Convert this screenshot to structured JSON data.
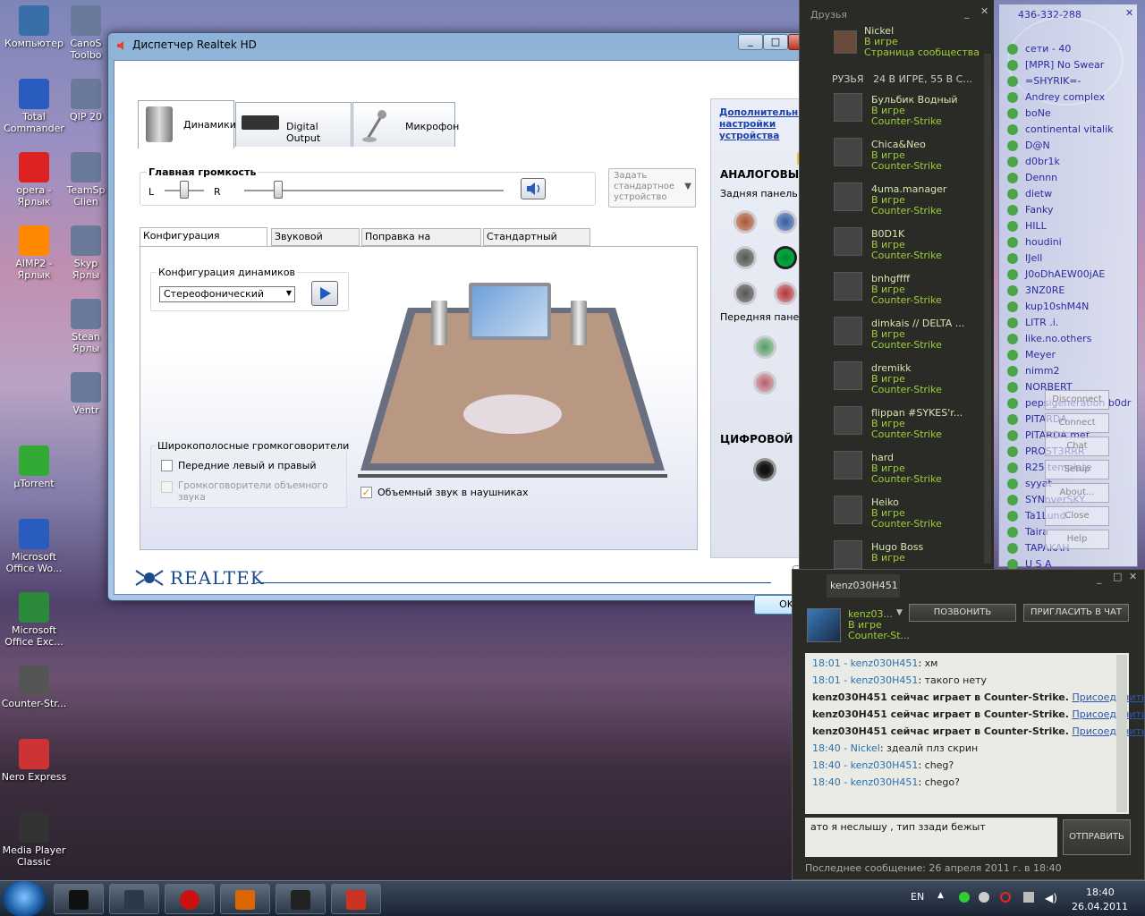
{
  "desktop_icons": [
    {
      "label": "Компьютер",
      "icon": "computer-icon"
    },
    {
      "label": "Total Commander",
      "icon": "total-commander-icon"
    },
    {
      "label": "opera - Ярлык",
      "icon": "opera-icon"
    },
    {
      "label": "AIMP2 - Ярлык",
      "icon": "aimp-icon"
    },
    {
      "label": "µTorrent",
      "icon": "utorrent-icon"
    },
    {
      "label": "Microsoft Office Wo...",
      "icon": "word-icon"
    },
    {
      "label": "Microsoft Office Exc...",
      "icon": "excel-icon"
    },
    {
      "label": "Counter-Str...",
      "icon": "counter-strike-icon"
    },
    {
      "label": "Nero Express",
      "icon": "nero-icon"
    },
    {
      "label": "Media Player Classic",
      "icon": "media-player-icon"
    }
  ],
  "desktop_icons_col2": [
    {
      "label": "CanoS Toolbo",
      "icon": "canon-icon"
    },
    {
      "label": "QIP 20",
      "icon": "qip-icon"
    },
    {
      "label": "TeamSp Clien",
      "icon": "teamspeak-icon"
    },
    {
      "label": "Skyp Ярлы",
      "icon": "skype-icon"
    },
    {
      "label": "Stean Ярлы",
      "icon": "steam-icon"
    },
    {
      "label": "Ventr",
      "icon": "ventrilo-icon"
    }
  ],
  "realtek": {
    "title": "Диспетчер Realtek HD",
    "tabs": [
      "Динамики",
      "Digital Output",
      "Микрофон"
    ],
    "master_volume_label": "Главная громкость",
    "balance_L": "L",
    "balance_R": "R",
    "set_default": "Задать стандартное устройство",
    "subtabs": [
      "Конфигурация динамиков",
      "Звуковой эффект",
      "Поправка на помещение",
      "Стандартный формат"
    ],
    "config_group_label": "Конфигурация динамиков",
    "config_selected": "Стереофонический",
    "wideband_label": "Широкополосные громкоговорители",
    "front_lr": "Передние левый и правый",
    "surround": "Громкоговорители объемного звука",
    "headphones": "Объемный звук в наушниках",
    "advanced_link": "Дополнительные настройки устройства",
    "analog_label": "АНАЛОГОВЫЙ",
    "rear_panel": "Задняя панель",
    "front_panel": "Передняя панель",
    "digital_label": "ЦИФРОВОЙ",
    "brand": "REALTEK",
    "ok": "OK",
    "master_volume": 0.22,
    "balance": 0.5
  },
  "steam_friends": {
    "title": "Друзья",
    "top_user": {
      "name": "Nickel",
      "status": "В игре",
      "sub": "Страница сообщества"
    },
    "header": "РУЗЬЯ   24 В ИГРЕ, 55 В С...",
    "friends": [
      {
        "name": "Бульбик Водный",
        "status": "В игре",
        "game": "Counter-Strike"
      },
      {
        "name": "Chica&Neo",
        "status": "В игре",
        "game": "Counter-Strike"
      },
      {
        "name": "4uma.manager",
        "status": "В игре",
        "game": "Counter-Strike"
      },
      {
        "name": "B0D1K",
        "status": "В игре",
        "game": "Counter-Strike"
      },
      {
        "name": "bnhgffff",
        "status": "В игре",
        "game": "Counter-Strike"
      },
      {
        "name": "dimkais // DELTA ...",
        "status": "В игре",
        "game": "Counter-Strike"
      },
      {
        "name": "dremikk",
        "status": "В игре",
        "game": "Counter-Strike"
      },
      {
        "name": "flippan #SYKES'r...",
        "status": "В игре",
        "game": "Counter-Strike"
      },
      {
        "name": "hard",
        "status": "В игре",
        "game": "Counter-Strike"
      },
      {
        "name": "Heiko",
        "status": "В игре",
        "game": "Counter-Strike"
      },
      {
        "name": "Hugo Boss",
        "status": "В игре",
        "game": ""
      }
    ]
  },
  "qip": {
    "title": "436-332-288",
    "contacts": [
      "сети - 40",
      "[MPR] No Swear",
      "=SHYRIK=-",
      "Andrey complex",
      "boNe",
      "continental vitalik",
      "D@N",
      "d0br1k",
      "Dennn",
      "dietw",
      "Fanky",
      "HILL",
      "houdini",
      "IJell",
      "J0oDhAEW00jAE",
      "3NZ0RE",
      "kup10shM4N",
      "LITR .i.",
      "like.no.others",
      "Meyer",
      "nimm2",
      "NORBERT",
      "pepsigeneration b0dr",
      "PITARDA",
      "PITARDA mef",
      "PROST3RRR",
      "R25 template",
      "syyat",
      "SYNoverSKY",
      "Ta1Lund",
      "Taira",
      "TAPAKAH",
      "U S A"
    ],
    "menu": [
      "Disconnect",
      "Connect",
      "Chat",
      "Setup",
      "About...",
      "Close",
      "Help"
    ]
  },
  "steam_chat": {
    "tab": "kenz030H451",
    "user": {
      "name": "kenz03...",
      "status": "В игре",
      "game": "Counter-St..."
    },
    "call_btn": "ПОЗВОНИТЬ",
    "invite_btn": "ПРИГЛАСИТЬ В ЧАТ",
    "messages": [
      {
        "time": "18:01",
        "who": "kenz030H451",
        "text": "хм",
        "kind": "msg"
      },
      {
        "time": "18:01",
        "who": "kenz030H451",
        "text": "такого нету",
        "kind": "msg"
      },
      {
        "text": "kenz030H451 сейчас играет в Counter-Strike.",
        "link": "Присоединиться",
        "kind": "sys"
      },
      {
        "text": "kenz030H451 сейчас играет в Counter-Strike.",
        "link": "Присоединиться",
        "kind": "sys"
      },
      {
        "text": "kenz030H451 сейчас играет в Counter-Strike.",
        "link": "Присоединиться",
        "kind": "sys"
      },
      {
        "time": "18:40",
        "who": "Nickel",
        "text": "здеалй плз скрин",
        "kind": "msg"
      },
      {
        "time": "18:40",
        "who": "kenz030H451",
        "text": "cheg?",
        "kind": "msg"
      },
      {
        "time": "18:40",
        "who": "kenz030H451",
        "text": "chego?",
        "kind": "msg"
      }
    ],
    "input_text": "ато я неслышу , тип ззади бежыт",
    "send_btn": "ОТПРАВИТЬ",
    "last_message": "Последнее сообщение: 26 апреля 2011 г. в 18:40"
  },
  "taskbar": {
    "lang": "EN",
    "time": "18:40",
    "date": "26.04.2011",
    "apps": [
      "cmd-icon",
      "steam-icon",
      "opera-icon",
      "half-life-icon",
      "game-icon",
      "speaker-icon"
    ]
  },
  "colors": {
    "steam_green": "#9fcf38",
    "qip_blue": "#2a2ca0",
    "realtek_blue": "#1a4b8e",
    "link": "#1a3fb0"
  }
}
